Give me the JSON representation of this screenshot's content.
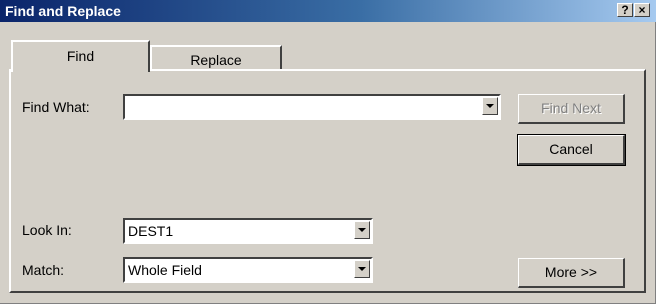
{
  "window": {
    "title": "Find and Replace",
    "help_glyph": "?",
    "close_glyph": "×"
  },
  "tabs": [
    {
      "label": "Find",
      "active": true
    },
    {
      "label": "Replace",
      "active": false
    }
  ],
  "find_what": {
    "label": "Find What:",
    "value": ""
  },
  "look_in": {
    "label": "Look In:",
    "value": "DEST1"
  },
  "match": {
    "label": "Match:",
    "value": "Whole Field"
  },
  "buttons": {
    "find_next": "Find Next",
    "cancel": "Cancel",
    "more": "More >>"
  },
  "colors": {
    "titlebar_start": "#0a246a",
    "titlebar_end": "#a6caf0",
    "face": "#d4d0c8"
  }
}
